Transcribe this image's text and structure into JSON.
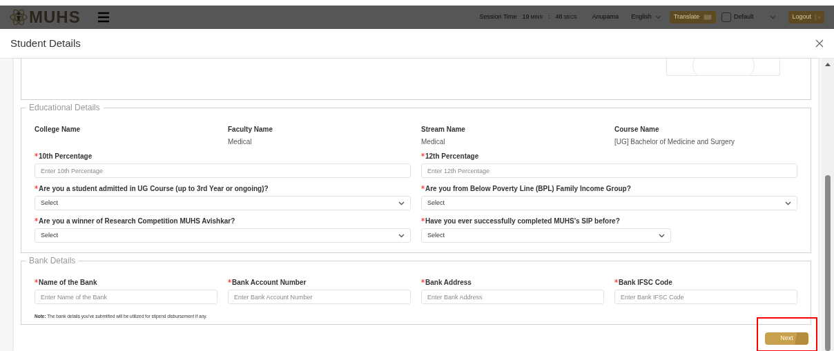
{
  "topbar": {
    "logo": "MUHS",
    "session": {
      "label": "Session Time",
      "minutes": "19",
      "minutes_unit": "MINS",
      "separator": ":",
      "seconds": "48",
      "seconds_unit": "SECS"
    },
    "user": "Anupama",
    "language": "English",
    "translate": "Translate",
    "theme": {
      "label": "Default",
      "checked": false
    },
    "logout": "Logout"
  },
  "modal": {
    "title": "Student Details",
    "educational": {
      "legend": "Educational Details",
      "info": [
        {
          "label": "College Name"
        },
        {
          "label": "Faculty Name",
          "value": "Medical"
        },
        {
          "label": "Stream Name",
          "value": "Medical"
        },
        {
          "label": "Course Name",
          "value": "[UG] Bachelor of Medicine and Surgery"
        }
      ],
      "fields": [
        {
          "kind": "input",
          "label": "10th Percentage",
          "required": true,
          "placeholder": "Enter 10th Percentage"
        },
        {
          "kind": "input",
          "label": "12th Percentage",
          "required": true,
          "placeholder": "Enter 12th Percentage"
        },
        {
          "kind": "select",
          "label": "Are you a student admitted in UG Course (up to 3rd Year or ongoing)?",
          "required": true,
          "value": "Select",
          "compact": false
        },
        {
          "kind": "select",
          "label": "Are you from Below Poverty Line (BPL) Family Income Group?",
          "required": true,
          "value": "Select",
          "compact": false
        },
        {
          "kind": "select",
          "label": "Are you a winner of Research Competition MUHS Avishkar?",
          "required": true,
          "value": "Select",
          "compact": false
        },
        {
          "kind": "select",
          "label": "Have you ever successfully completed MUHS's SIP before?",
          "required": true,
          "value": "Select",
          "compact": true
        }
      ]
    },
    "bank": {
      "legend": "Bank Details",
      "fields": [
        {
          "kind": "input",
          "label": "Name of the Bank",
          "required": true,
          "placeholder": "Enter Name of the Bank"
        },
        {
          "kind": "input",
          "label": "Bank Account Number",
          "required": true,
          "placeholder": "Enter Bank Account Number"
        },
        {
          "kind": "input",
          "label": "Bank Address",
          "required": true,
          "placeholder": "Enter Bank Address"
        },
        {
          "kind": "input",
          "label": "Bank IFSC Code",
          "required": true,
          "placeholder": "Enter Bank IFSC Code"
        }
      ],
      "note": "**Note:** The bank details you've submitted will be utilized for stipend disbursement if any."
    },
    "next": "Next"
  }
}
